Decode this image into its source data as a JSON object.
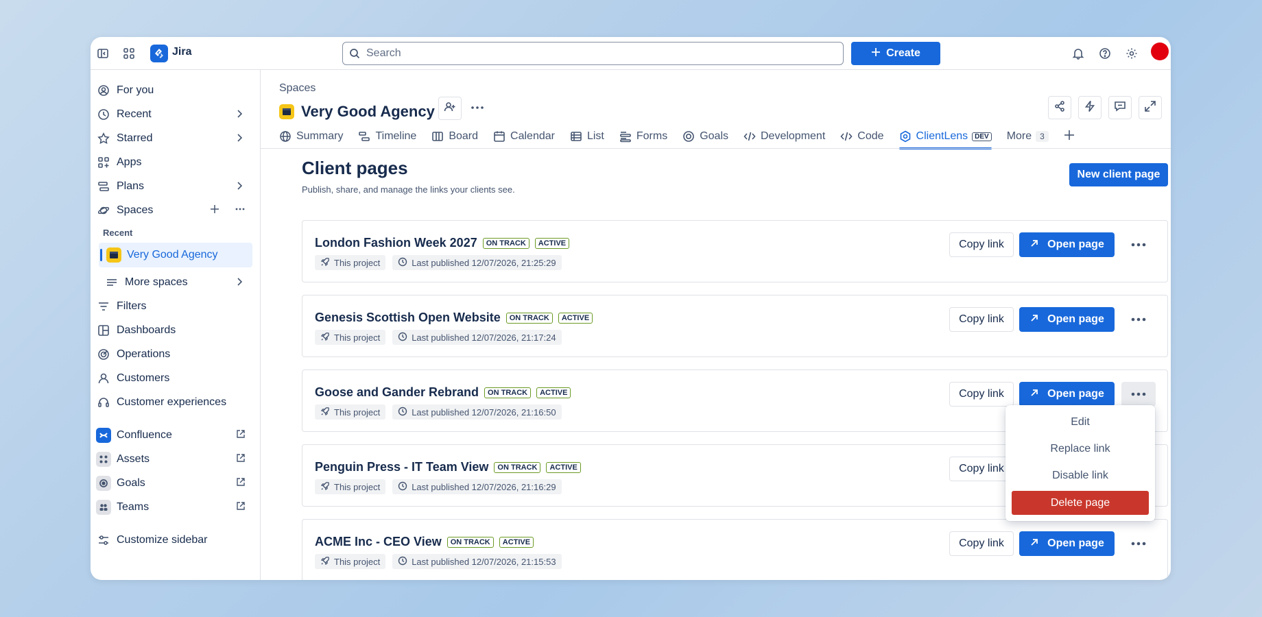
{
  "topbar": {
    "app_name": "Jira",
    "search_placeholder": "Search",
    "create_label": "Create"
  },
  "sidebar": {
    "items": [
      {
        "label": "For you"
      },
      {
        "label": "Recent"
      },
      {
        "label": "Starred"
      },
      {
        "label": "Apps"
      },
      {
        "label": "Plans"
      },
      {
        "label": "Spaces"
      }
    ],
    "recent_heading": "Recent",
    "active_space": "Very Good Agency",
    "more_spaces": "More spaces",
    "items2": [
      {
        "label": "Filters"
      },
      {
        "label": "Dashboards"
      },
      {
        "label": "Operations"
      },
      {
        "label": "Customers"
      },
      {
        "label": "Customer experiences"
      }
    ],
    "apps": [
      {
        "label": "Confluence",
        "color": "#1868db"
      },
      {
        "label": "Assets",
        "color": "#44546f"
      },
      {
        "label": "Goals",
        "color": "#44546f"
      },
      {
        "label": "Teams",
        "color": "#44546f"
      }
    ],
    "customize": "Customize sidebar"
  },
  "header": {
    "breadcrumb": "Spaces",
    "space_name": "Very Good Agency",
    "tabs": [
      {
        "label": "Summary"
      },
      {
        "label": "Timeline"
      },
      {
        "label": "Board"
      },
      {
        "label": "Calendar"
      },
      {
        "label": "List"
      },
      {
        "label": "Forms"
      },
      {
        "label": "Goals"
      },
      {
        "label": "Development"
      },
      {
        "label": "Code"
      },
      {
        "label": "ClientLens",
        "badge": "DEV"
      },
      {
        "label": "More",
        "count": "3"
      }
    ]
  },
  "page": {
    "title": "Client pages",
    "subtitle": "Publish, share, and manage the links your clients see.",
    "new_button": "New client page"
  },
  "cards": [
    {
      "name": "London Fashion Week 2027",
      "status": "ON TRACK",
      "state": "ACTIVE",
      "scope": "This project",
      "published": "Last published 12/07/2026, 21:25:29"
    },
    {
      "name": "Genesis Scottish Open Website",
      "status": "ON TRACK",
      "state": "ACTIVE",
      "scope": "This project",
      "published": "Last published 12/07/2026, 21:17:24"
    },
    {
      "name": "Goose and Gander Rebrand",
      "status": "ON TRACK",
      "state": "ACTIVE",
      "scope": "This project",
      "published": "Last published 12/07/2026, 21:16:50"
    },
    {
      "name": "Penguin Press - IT Team View",
      "status": "ON TRACK",
      "state": "ACTIVE",
      "scope": "This project",
      "published": "Last published 12/07/2026, 21:16:29"
    },
    {
      "name": "ACME Inc - CEO View",
      "status": "ON TRACK",
      "state": "ACTIVE",
      "scope": "This project",
      "published": "Last published 12/07/2026, 21:15:53"
    }
  ],
  "card_actions": {
    "copy": "Copy link",
    "open": "Open page"
  },
  "menu": {
    "edit": "Edit",
    "replace": "Replace link",
    "disable": "Disable link",
    "delete": "Delete page"
  },
  "colors": {
    "accent": "#1868db",
    "danger": "#c9372c",
    "lozenge_border": "#6a9a23"
  }
}
